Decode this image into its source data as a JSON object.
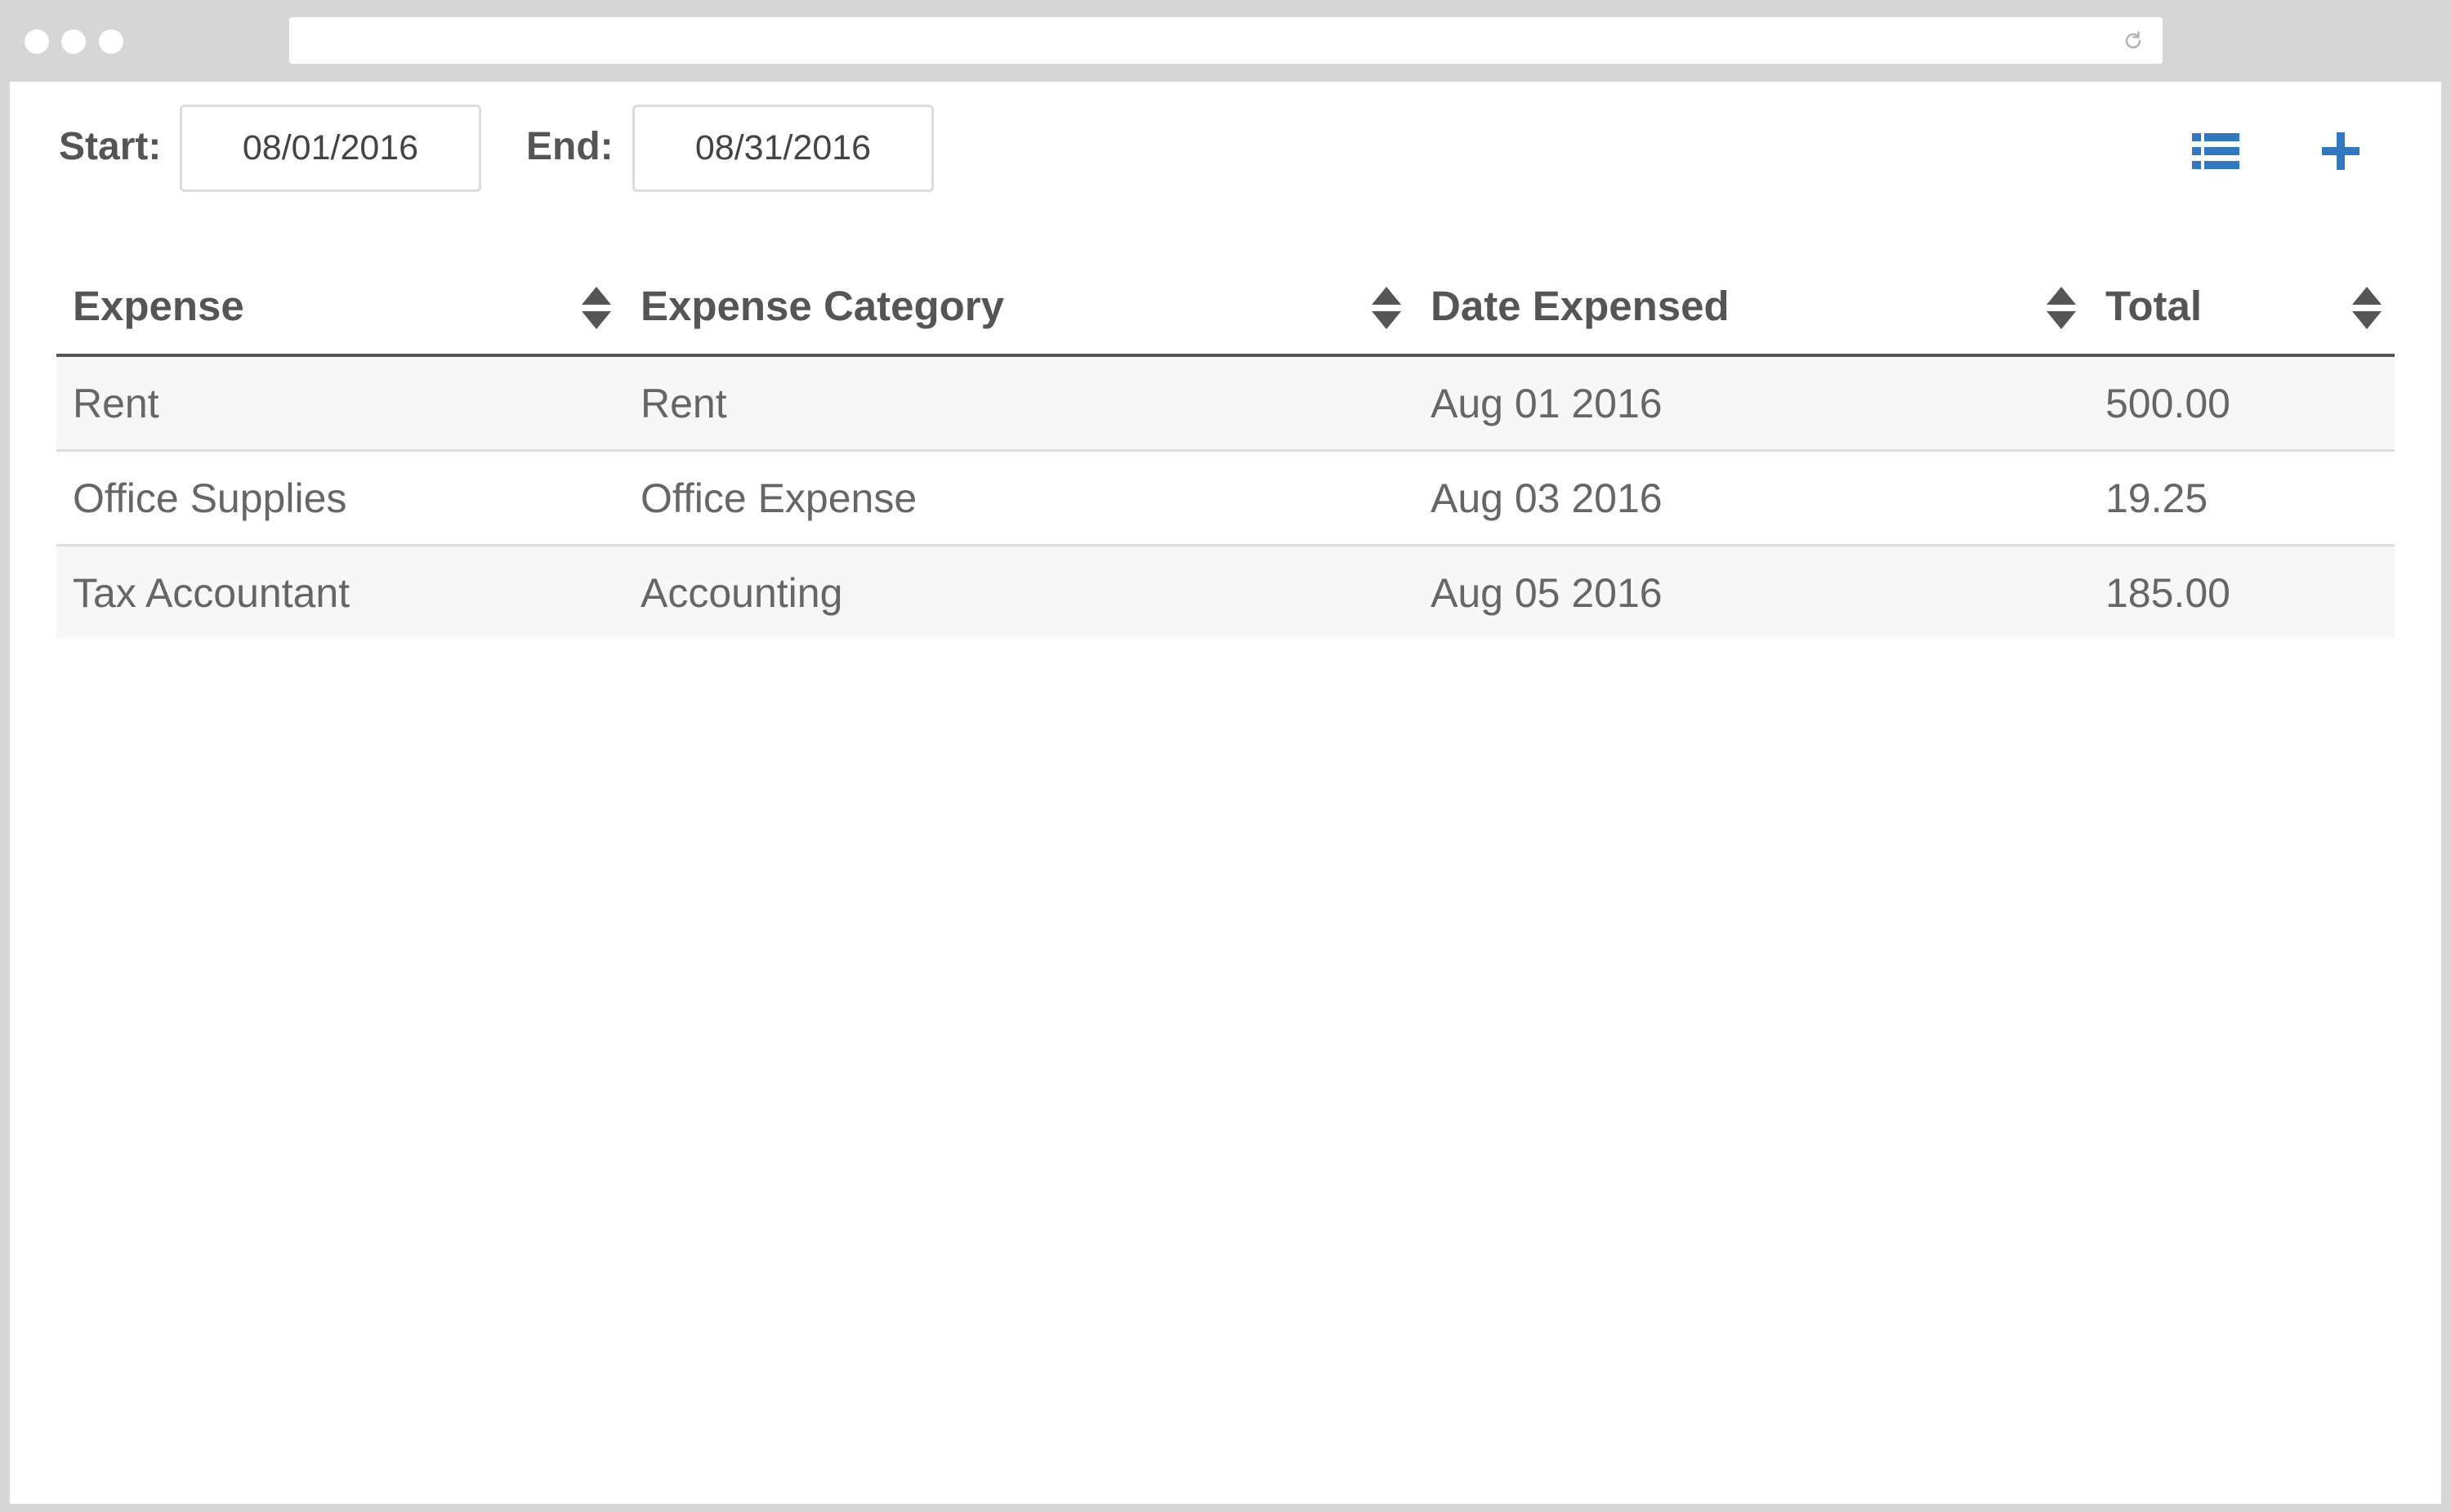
{
  "browser": {
    "window_controls": [
      "close",
      "minimize",
      "maximize"
    ],
    "address": "",
    "reload_icon": "reload-icon"
  },
  "filters": {
    "start_label": "Start:",
    "start_value": "08/01/2016",
    "end_label": "End:",
    "end_value": "08/31/2016"
  },
  "toolbar": {
    "list_icon": "list-icon",
    "add_icon": "plus-icon",
    "accent_color": "#3079c2"
  },
  "table": {
    "columns": [
      "Expense",
      "Expense Category",
      "Date Expensed",
      "Total"
    ],
    "rows": [
      [
        "Rent",
        "Rent",
        "Aug 01 2016",
        "500.00"
      ],
      [
        "Office Supplies",
        "Office Expense",
        "Aug 03 2016",
        "19.25"
      ],
      [
        "Tax Accountant",
        "Accounting",
        "Aug 05 2016",
        "185.00"
      ]
    ]
  }
}
